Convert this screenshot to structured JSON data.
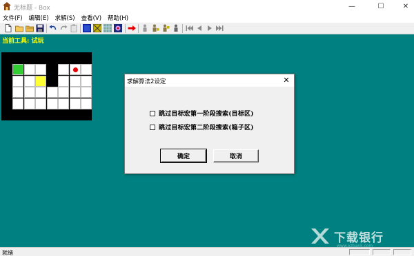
{
  "window": {
    "title": "无标题 - Box",
    "minimize_glyph": "—",
    "maximize_glyph": "☐",
    "close_glyph": "✕"
  },
  "menu": [
    "文件(F)",
    "编辑(E)",
    "求解(S)",
    "查看(V)",
    "帮助(H)"
  ],
  "toolbar_icons": [
    "new-file-icon",
    "open-folder-icon",
    "open-folder-alt-icon",
    "save-icon",
    "undo-icon",
    "redo-icon",
    "clipboard-icon",
    "wall-tile-icon",
    "box-tile-icon",
    "floor-tile-icon",
    "target-tile-icon",
    "run-arrow-icon",
    "man-icon",
    "man-push-icon",
    "man-step-icon",
    "man-alt-icon",
    "first-icon",
    "prev-icon",
    "next-icon",
    "last-icon"
  ],
  "main": {
    "current_tool_label": "当前工具: 试玩",
    "background_color": "#008080",
    "tool_label_color": "#ffff00",
    "board": {
      "rows": 4,
      "cols": 7,
      "walls": [
        [
          0,
          3
        ],
        [
          1,
          3
        ]
      ],
      "player": [
        0,
        0
      ],
      "box": [
        1,
        2
      ],
      "target": [
        0,
        5
      ],
      "player_color": "#33cc33",
      "box_color": "#ffff33",
      "target_color": "#e60000"
    }
  },
  "dialog": {
    "title": "求解算法2设定",
    "close_glyph": "✕",
    "options": [
      {
        "label": "跳过目标宏第一阶段搜索(目标区)",
        "checked": false
      },
      {
        "label": "跳过目标宏第二阶段搜索(箱子区)",
        "checked": false
      }
    ],
    "ok_label": "确定",
    "cancel_label": "取消"
  },
  "watermark": {
    "text": "下载银行",
    "url": "www.xzbank.com"
  },
  "statusbar": {
    "text": "就绪"
  }
}
